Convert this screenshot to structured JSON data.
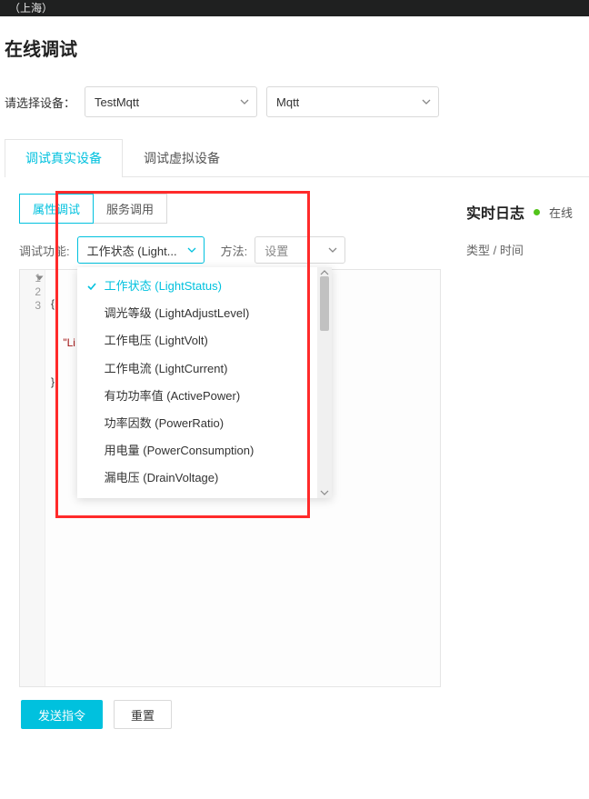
{
  "topbar": "（上海）",
  "page_title": "在线调试",
  "device": {
    "label": "请选择设备：",
    "select1": "TestMqtt",
    "select2": "Mqtt"
  },
  "tabs_l1": {
    "real": "调试真实设备",
    "virtual": "调试虚拟设备"
  },
  "tabs_l2": {
    "property": "属性调试",
    "service": "服务调用"
  },
  "func": {
    "label": "调试功能:",
    "selected": "工作状态 (Light...",
    "options": [
      "工作状态 (LightStatus)",
      "调光等级 (LightAdjustLevel)",
      "工作电压 (LightVolt)",
      "工作电流 (LightCurrent)",
      "有功功率值 (ActivePower)",
      "功率因数 (PowerRatio)",
      "用电量 (PowerConsumption)",
      "漏电压 (DrainVoltage)"
    ]
  },
  "method": {
    "label": "方法:",
    "value": "设置"
  },
  "code": {
    "l1": "{",
    "l2_prefix": "    ",
    "l2_key": "\"Li",
    "l3": "}"
  },
  "buttons": {
    "send": "发送指令",
    "reset": "重置"
  },
  "log": {
    "title": "实时日志",
    "status": "在线",
    "th": "类型 / 时间"
  },
  "gutter": {
    "n1": "1",
    "n2": "2",
    "n3": "3"
  }
}
